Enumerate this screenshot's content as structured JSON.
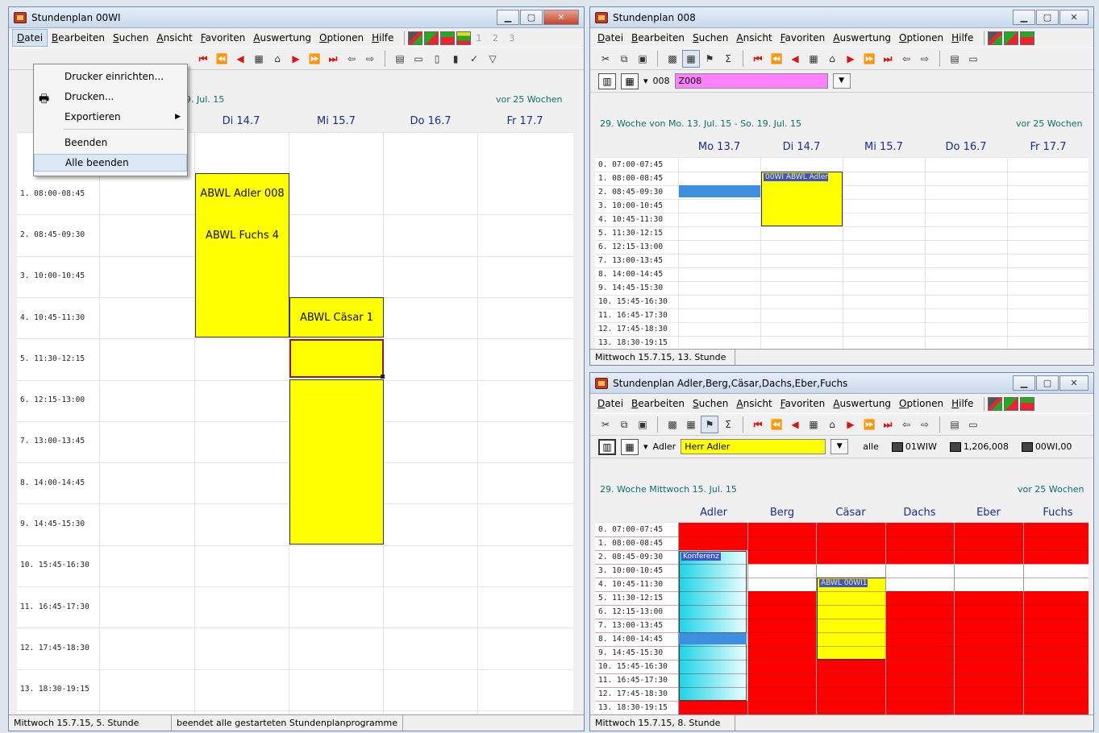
{
  "w1": {
    "title": "Stundenplan 00WI",
    "menu": [
      "Datei",
      "Bearbeiten",
      "Suchen",
      "Ansicht",
      "Favoriten",
      "Auswertung",
      "Optionen",
      "Hilfe"
    ],
    "menu_numbers": "1 2 3",
    "week_range": "19. Jul. 15",
    "weeks_ago": "vor 25 Wochen",
    "days": [
      "Di 14.7",
      "Mi 15.7",
      "Do 16.7",
      "Fr 17.7"
    ],
    "periods": [
      "1. 08:00-08:45",
      "2. 08:45-09:30",
      "3. 10:00-10:45",
      "4. 10:45-11:30",
      "5. 11:30-12:15",
      "6. 12:15-13:00",
      "7. 13:00-13:45",
      "8. 14:00-14:45",
      "9. 14:45-15:30",
      "10. 15:45-16:30",
      "11. 16:45-17:30",
      "12. 17:45-18:30",
      "13. 18:30-19:15"
    ],
    "lessons": [
      "ABWL Adler 008",
      "ABWL Fuchs 4",
      "ABWL Cäsar 1"
    ],
    "status": [
      "Mittwoch 15.7.15, 5. Stunde",
      "beendet alle gestarteten Stundenplanprogramme"
    ],
    "dropdown": [
      "Drucker einrichten...",
      "Drucken...",
      "Exportieren",
      "Beenden",
      "Alle beenden"
    ]
  },
  "w2": {
    "title": "Stundenplan 008",
    "menu": [
      "Datei",
      "Bearbeiten",
      "Suchen",
      "Ansicht",
      "Favoriten",
      "Auswertung",
      "Optionen",
      "Hilfe"
    ],
    "selector_short": "008",
    "selector_value": "Z008",
    "week_range": "29. Woche von Mo. 13. Jul. 15 - So. 19. Jul. 15",
    "weeks_ago": "vor 25 Wochen",
    "days": [
      "Mo 13.7",
      "Di 14.7",
      "Mi 15.7",
      "Do 16.7",
      "Fr 17.7"
    ],
    "periods": [
      "0. 07:00-07:45",
      "1. 08:00-08:45",
      "2. 08:45-09:30",
      "3. 10:00-10:45",
      "4. 10:45-11:30",
      "5. 11:30-12:15",
      "6. 12:15-13:00",
      "7. 13:00-13:45",
      "8. 14:00-14:45",
      "9. 14:45-15:30",
      "10. 15:45-16:30",
      "11. 16:45-17:30",
      "12. 17:45-18:30",
      "13. 18:30-19:15"
    ],
    "lesson": "00WI ABWL Adler",
    "status": "Mittwoch 15.7.15, 13. Stunde"
  },
  "w3": {
    "title": "Stundenplan Adler,Berg,Cäsar,Dachs,Eber,Fuchs",
    "menu": [
      "Datei",
      "Bearbeiten",
      "Suchen",
      "Ansicht",
      "Favoriten",
      "Auswertung",
      "Optionen",
      "Hilfe"
    ],
    "selector_short": "Adler",
    "selector_value": "Herr Adler",
    "filter": "alle",
    "chip1": "01WIW",
    "chip2": "1,206,008",
    "chip3": "00WI,00",
    "week_range": "29. Woche Mittwoch 15. Jul. 15",
    "weeks_ago": "vor 25 Wochen",
    "teachers": [
      "Adler",
      "Berg",
      "Cäsar",
      "Dachs",
      "Eber",
      "Fuchs"
    ],
    "periods": [
      "0. 07:00-07:45",
      "1. 08:00-08:45",
      "2. 08:45-09:30",
      "3. 10:00-10:45",
      "4. 10:45-11:30",
      "5. 11:30-12:15",
      "6. 12:15-13:00",
      "7. 13:00-13:45",
      "8. 14:00-14:45",
      "9. 14:45-15:30",
      "10. 15:45-16:30",
      "11. 16:45-17:30",
      "12. 17:45-18:30",
      "13. 18:30-19:15"
    ],
    "konferenz": "Konferenz",
    "lesson": "ABWL 00WI1",
    "status": "Mittwoch 15.7.15, 8. Stunde"
  }
}
